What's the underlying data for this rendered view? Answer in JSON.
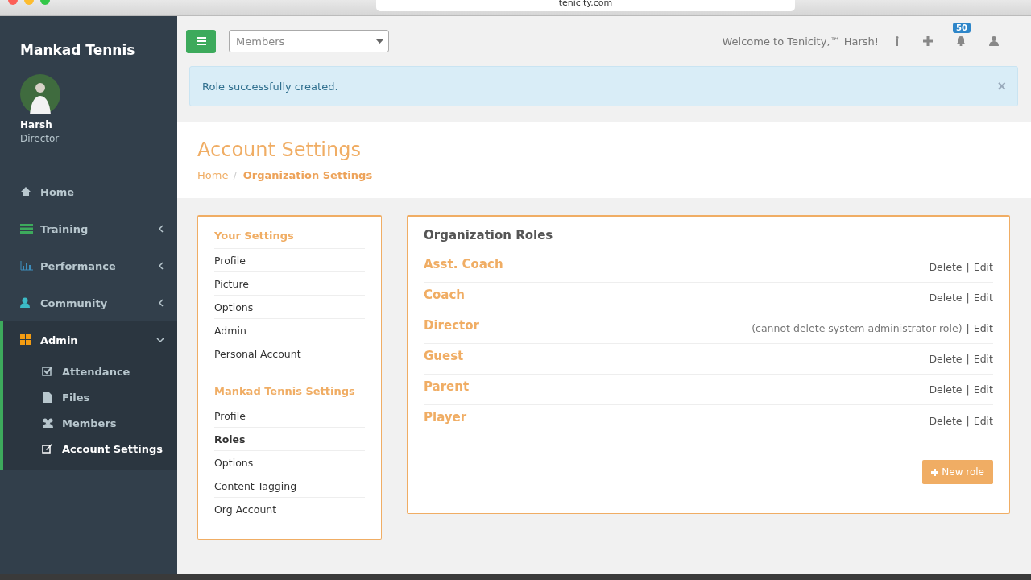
{
  "browser": {
    "url": "tenicity.com"
  },
  "sidebar": {
    "brand": "Mankad Tennis",
    "user": {
      "name": "Harsh",
      "role": "Director"
    },
    "items": [
      {
        "kind": "link",
        "label": "Home",
        "selected": false
      },
      {
        "kind": "menu",
        "label": "Training",
        "selected": false,
        "expanded": false
      },
      {
        "kind": "menu",
        "label": "Performance",
        "selected": false,
        "expanded": false
      },
      {
        "kind": "menu",
        "label": "Community",
        "selected": false,
        "expanded": false
      },
      {
        "kind": "menu",
        "label": "Admin",
        "selected": true,
        "expanded": true,
        "children": [
          {
            "label": "Attendance",
            "selected": false
          },
          {
            "label": "Files",
            "selected": false
          },
          {
            "label": "Members",
            "selected": false
          },
          {
            "label": "Account Settings",
            "selected": true
          }
        ]
      }
    ]
  },
  "topbar": {
    "select": {
      "value": "Members"
    },
    "welcome": "Welcome to Tenicity,™ Harsh!",
    "notifications": "50"
  },
  "alert": {
    "text": "Role successfully created.",
    "close": "×"
  },
  "header": {
    "title": "Account Settings",
    "breadcrumb": [
      {
        "label": "Home",
        "selected": false
      },
      {
        "label": "Organization Settings",
        "selected": true
      }
    ],
    "separator": "/"
  },
  "settings": {
    "groups": [
      {
        "title": "Your Settings",
        "items": [
          {
            "label": "Profile",
            "selected": false
          },
          {
            "label": "Picture",
            "selected": false
          },
          {
            "label": "Options",
            "selected": false
          },
          {
            "label": "Admin",
            "selected": false
          },
          {
            "label": "Personal Account",
            "selected": false
          }
        ]
      },
      {
        "title": "Mankad Tennis Settings",
        "items": [
          {
            "label": "Profile",
            "selected": false
          },
          {
            "label": "Roles",
            "selected": true
          },
          {
            "label": "Options",
            "selected": false
          },
          {
            "label": "Content Tagging",
            "selected": false
          },
          {
            "label": "Org Account",
            "selected": false
          }
        ]
      }
    ]
  },
  "roles": {
    "title": "Organization Roles",
    "separator": "|",
    "new_button": "New role",
    "items": [
      {
        "name": "Asst. Coach",
        "delete": "Delete",
        "edit": "Edit"
      },
      {
        "name": "Coach",
        "delete": "Delete",
        "edit": "Edit"
      },
      {
        "name": "Director",
        "note": "(cannot delete system administrator role)",
        "edit": "Edit"
      },
      {
        "name": "Guest",
        "delete": "Delete",
        "edit": "Edit"
      },
      {
        "name": "Parent",
        "delete": "Delete",
        "edit": "Edit"
      },
      {
        "name": "Player",
        "delete": "Delete",
        "edit": "Edit"
      }
    ]
  }
}
